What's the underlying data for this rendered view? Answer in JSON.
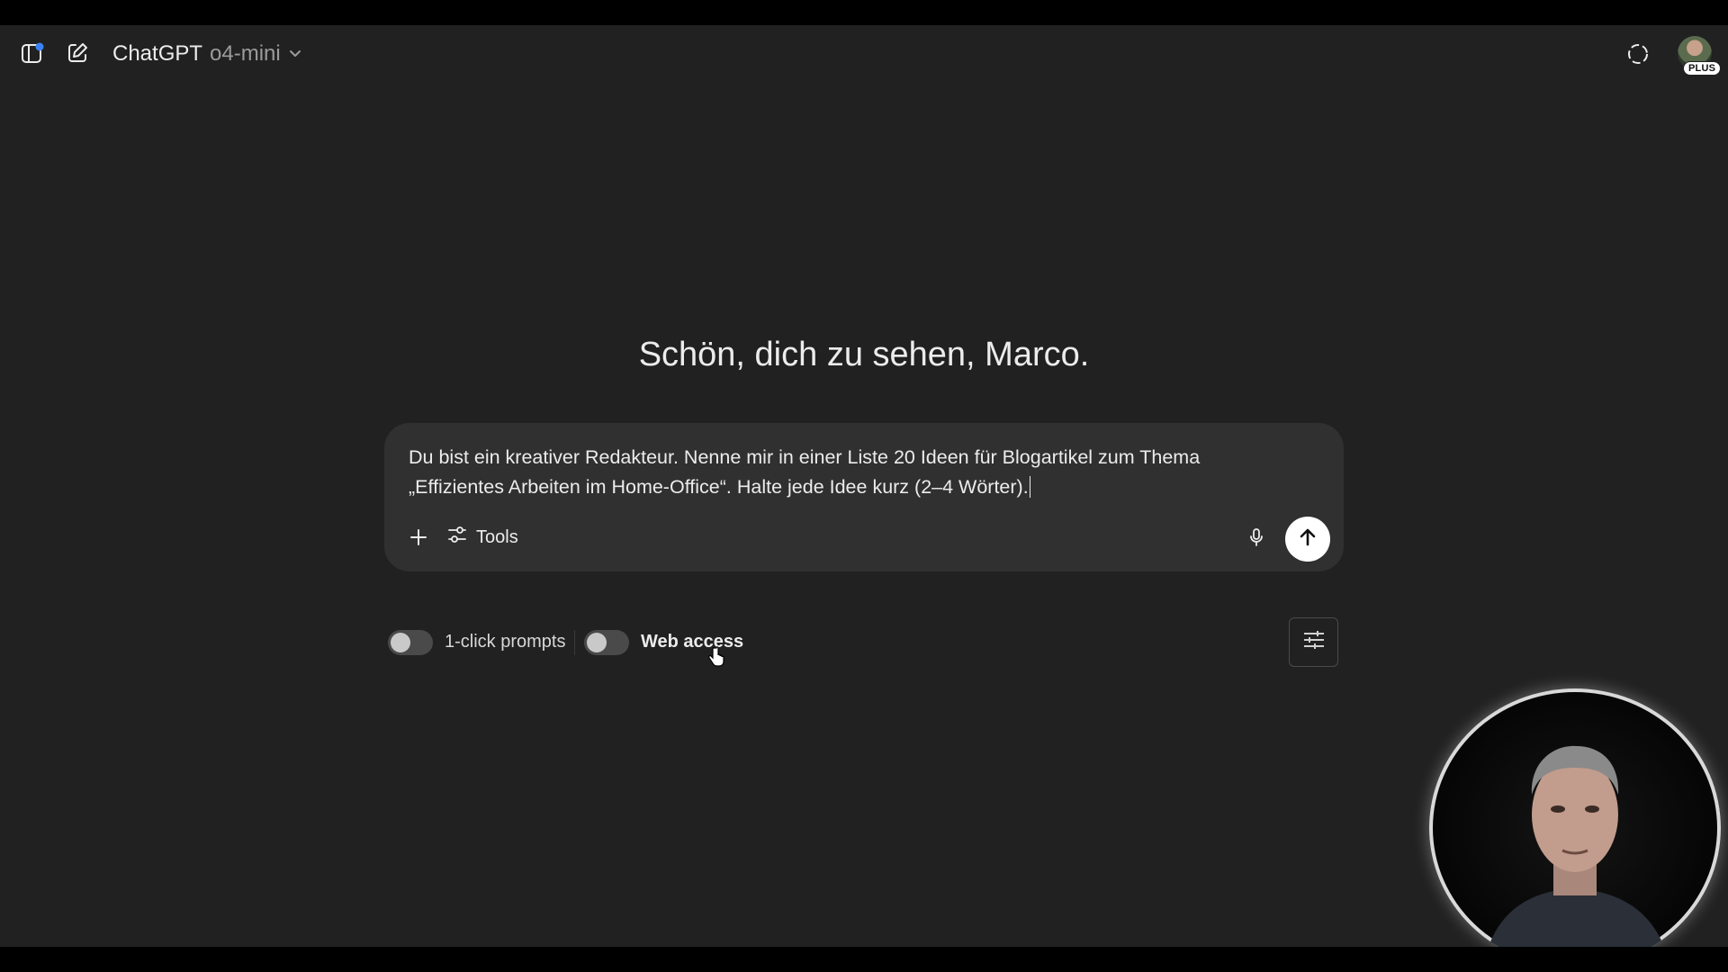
{
  "header": {
    "sidebar_toggle_icon": "sidebar-icon",
    "new_chat_icon": "edit-icon",
    "app_name": "ChatGPT",
    "model_name": "o4-mini",
    "temporary_chat_icon": "dashed-circle-icon",
    "plan_badge": "PLUS",
    "notification_dot_color": "#3b82f6"
  },
  "main": {
    "greeting": "Schön, dich zu sehen, Marco."
  },
  "composer": {
    "prompt_line_1": "Du bist ein kreativer Redakteur. Nenne mir in einer Liste 20 Ideen für Blogartikel zum Thema",
    "prompt_line_2": "„Effizientes Arbeiten im Home-Office“. Halte jede Idee kurz (2–4 Wörter).",
    "add_icon": "plus-icon",
    "tools_label": "Tools",
    "tools_icon": "sliders-icon",
    "mic_icon": "microphone-icon",
    "send_icon": "arrow-up-icon"
  },
  "options": {
    "one_click_prompts_label": "1-click prompts",
    "one_click_prompts_enabled": false,
    "web_access_label": "Web access",
    "web_access_enabled": false,
    "settings_icon": "settings-sliders-icon"
  },
  "colors": {
    "background": "#212121",
    "composer_background": "#303030",
    "text": "#ececec",
    "muted_text": "#9b9b9b",
    "send_button": "#ffffff"
  }
}
